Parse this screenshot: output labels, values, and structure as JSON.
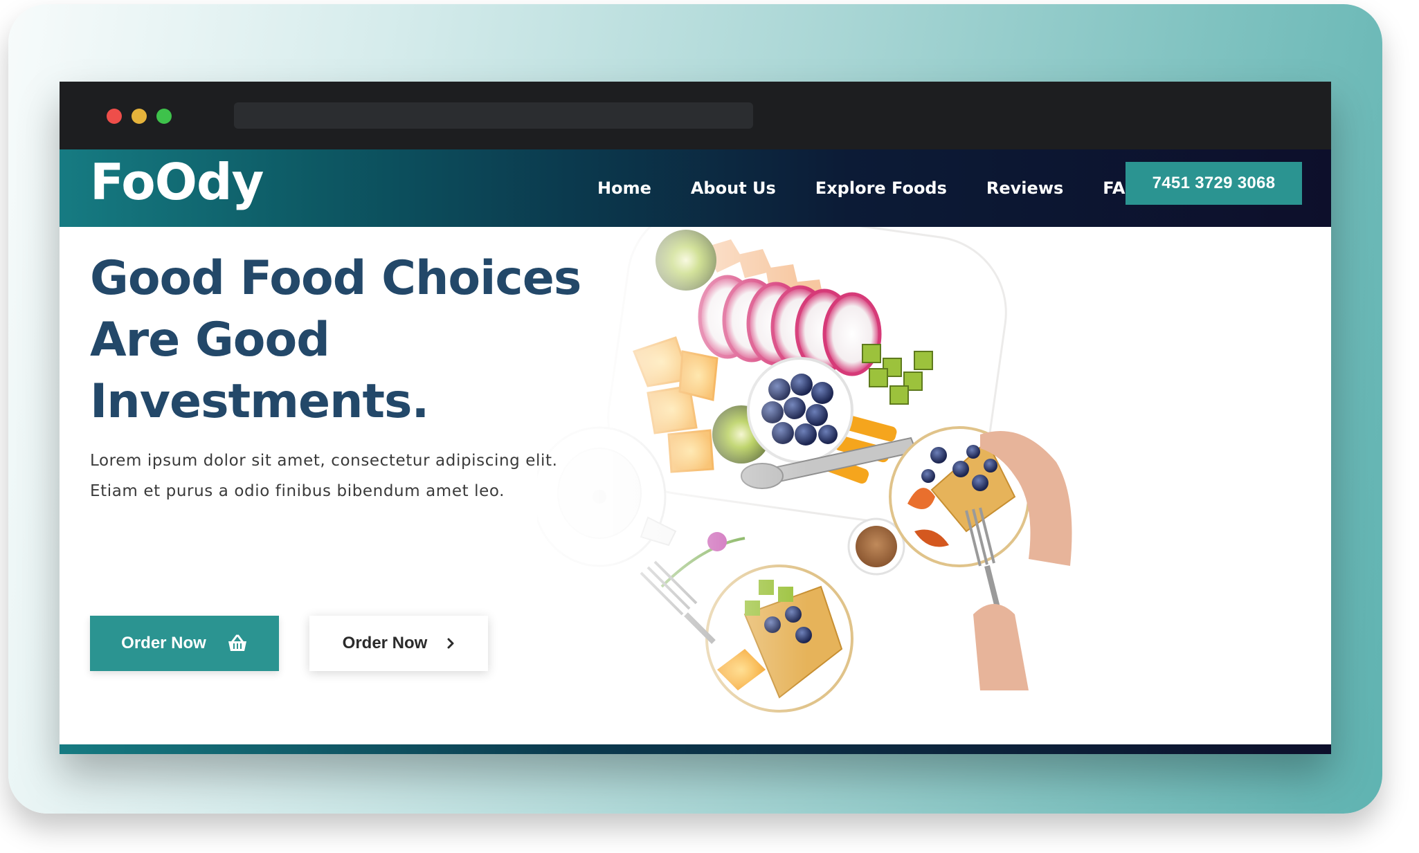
{
  "brand": {
    "logo_text": "FoOdy"
  },
  "nav": {
    "items": [
      {
        "label": "Home"
      },
      {
        "label": "About Us"
      },
      {
        "label": "Explore Foods"
      },
      {
        "label": "Reviews"
      },
      {
        "label": "FAQ"
      }
    ],
    "phone": "7451 3729 3068"
  },
  "hero": {
    "headline_line1": "Good Food Choices",
    "headline_line2": "Are Good",
    "headline_line3": "Investments.",
    "subtext_line1": "Lorem ipsum dolor sit amet, consectetur adipiscing elit.",
    "subtext_line2": "Etiam et purus a odio finibus bibendum amet leo.",
    "primary_button": {
      "label": "Order Now",
      "icon": "basket-icon"
    },
    "secondary_button": {
      "label": "Order Now",
      "icon": "chevron-right-icon"
    },
    "image_alt": "food-spread-photo"
  },
  "colors": {
    "accent": "#2b9491",
    "headline": "#234869",
    "nav_dark": "#0d0f2b",
    "chrome": "#1d1e20",
    "traffic_red": "#ee4e4a",
    "traffic_yellow": "#e5b33b",
    "traffic_green": "#3ec24b"
  }
}
